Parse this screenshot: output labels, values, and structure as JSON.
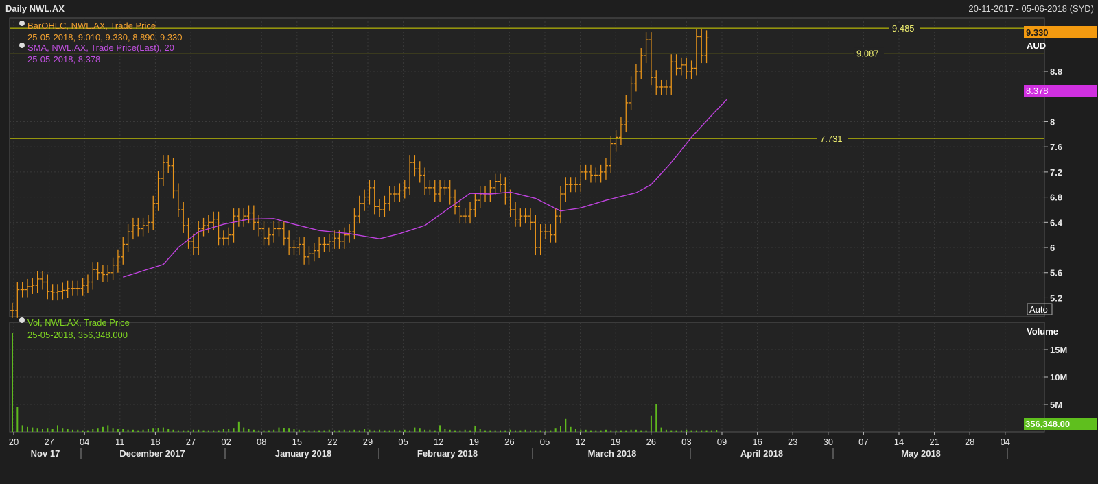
{
  "header": {
    "title": "Daily NWL.AX",
    "date_range": "20-11-2017 - 05-06-2018 (SYD)"
  },
  "colors": {
    "background": "#1e1e1e",
    "panel": "#222222",
    "grid": "#3a3a3a",
    "bar": "#e8941a",
    "sma": "#c043e0",
    "hline": "#d8d800",
    "volume": "#5fb81e",
    "last_price_bg": "#f39a10",
    "sma_bg": "#d030e0"
  },
  "price_panel": {
    "legend": [
      {
        "name": "BarOHLC, NWL.AX, Trade Price",
        "values": "25-05-2018, 9.010, 9.330, 8.890, 9.330",
        "color": "#f0a030"
      },
      {
        "name": "SMA, NWL.AX, Trade Price(Last),  20",
        "values": "25-05-2018, 8.378",
        "color": "#c050e0"
      }
    ],
    "currency": "AUD",
    "auto_label": "Auto",
    "last_price_tag": "9.330",
    "sma_tag": "8.378",
    "hlines": [
      {
        "label": "9.485",
        "value": 9.485
      },
      {
        "label": "9.087",
        "value": 9.087
      },
      {
        "label": "7.731",
        "value": 7.731
      }
    ]
  },
  "volume_panel": {
    "legend": {
      "name": "Vol, NWL.AX, Trade Price",
      "values": "25-05-2018, 356,348.000"
    },
    "title": "Volume",
    "last_volume_tag": "356,348.00"
  },
  "chart_data": [
    {
      "type": "ohlc",
      "series_name": "BarOHLC, NWL.AX, Trade Price",
      "ylim": [
        4.9,
        9.65
      ],
      "yticks": [
        "5.2",
        "5.6",
        "6",
        "6.4",
        "6.8",
        "7.2",
        "7.6",
        "8",
        "8.8"
      ],
      "x_ticks": [
        "20",
        "27",
        "04",
        "11",
        "18",
        "27",
        "02",
        "08",
        "15",
        "22",
        "29",
        "05",
        "12",
        "19",
        "26",
        "05",
        "12",
        "19",
        "26",
        "03",
        "09",
        "16",
        "23",
        "30",
        "07",
        "14",
        "21",
        "28",
        "04"
      ],
      "x_months": [
        "Nov 17",
        "December 2017",
        "January 2018",
        "February 2018",
        "March 2018",
        "April 2018",
        "May 2018"
      ],
      "close": [
        5.0,
        5.33,
        5.33,
        5.38,
        5.4,
        5.5,
        5.45,
        5.3,
        5.28,
        5.3,
        5.32,
        5.35,
        5.35,
        5.35,
        5.4,
        5.45,
        5.65,
        5.6,
        5.57,
        5.6,
        5.72,
        5.85,
        6.05,
        6.25,
        6.35,
        6.3,
        6.35,
        6.4,
        6.7,
        7.1,
        7.35,
        7.3,
        6.9,
        6.6,
        6.35,
        6.1,
        6.0,
        6.3,
        6.35,
        6.4,
        6.45,
        6.15,
        6.15,
        6.2,
        6.5,
        6.45,
        6.5,
        6.55,
        6.4,
        6.3,
        6.15,
        6.2,
        6.3,
        6.3,
        6.15,
        6.0,
        6.0,
        6.05,
        5.85,
        5.9,
        5.95,
        6.05,
        6.05,
        6.1,
        6.15,
        6.1,
        6.2,
        6.25,
        6.5,
        6.7,
        6.8,
        6.95,
        6.65,
        6.6,
        6.7,
        6.85,
        6.85,
        6.9,
        6.95,
        7.35,
        7.25,
        7.15,
        6.95,
        6.95,
        6.85,
        6.95,
        6.95,
        6.8,
        6.65,
        6.5,
        6.5,
        6.6,
        6.75,
        6.85,
        6.85,
        6.95,
        7.05,
        7.0,
        6.8,
        6.6,
        6.45,
        6.5,
        6.5,
        6.4,
        6.0,
        6.25,
        6.25,
        6.2,
        6.5,
        6.85,
        7.0,
        7.0,
        7.0,
        7.2,
        7.2,
        7.15,
        7.15,
        7.2,
        7.3,
        7.65,
        7.75,
        7.95,
        8.3,
        8.6,
        8.8,
        9.05,
        9.3,
        8.7,
        8.55,
        8.55,
        8.55,
        8.95,
        8.85,
        8.9,
        8.8,
        8.85,
        9.35,
        9.05,
        9.33
      ],
      "high_low_spread": 0.12
    },
    {
      "type": "line",
      "series_name": "SMA, NWL.AX, Trade Price(Last),  20",
      "points": [
        [
          22,
          5.53
        ],
        [
          26,
          5.63
        ],
        [
          30,
          5.73
        ],
        [
          33,
          6.0
        ],
        [
          37,
          6.25
        ],
        [
          42,
          6.37
        ],
        [
          47,
          6.45
        ],
        [
          52,
          6.46
        ],
        [
          56,
          6.37
        ],
        [
          61,
          6.27
        ],
        [
          67,
          6.22
        ],
        [
          73,
          6.14
        ],
        [
          77,
          6.22
        ],
        [
          82,
          6.35
        ],
        [
          86,
          6.58
        ],
        [
          91,
          6.86
        ],
        [
          95,
          6.85
        ],
        [
          99,
          6.88
        ],
        [
          104,
          6.78
        ],
        [
          109,
          6.58
        ],
        [
          113,
          6.63
        ],
        [
          118,
          6.75
        ],
        [
          124,
          6.87
        ],
        [
          127,
          7.0
        ],
        [
          131,
          7.35
        ],
        [
          135,
          7.75
        ],
        [
          139,
          8.1
        ],
        [
          142,
          8.35
        ]
      ]
    },
    {
      "type": "bar",
      "series_name": "Vol, NWL.AX, Trade Price",
      "unit": "M",
      "ylim": [
        0,
        20
      ],
      "yticks": [
        "5M",
        "10M",
        "15M"
      ],
      "values": [
        18.0,
        4.5,
        1.2,
        0.9,
        0.8,
        0.6,
        0.5,
        0.6,
        0.5,
        1.2,
        0.6,
        0.5,
        0.4,
        0.4,
        0.3,
        0.3,
        0.5,
        0.6,
        0.9,
        1.2,
        0.6,
        0.5,
        0.5,
        0.4,
        0.4,
        0.3,
        0.4,
        0.5,
        0.6,
        0.7,
        0.8,
        0.5,
        0.4,
        0.3,
        0.3,
        0.3,
        0.4,
        0.4,
        0.3,
        0.3,
        0.3,
        0.3,
        0.5,
        0.5,
        0.6,
        1.9,
        0.8,
        0.5,
        0.4,
        0.3,
        0.3,
        0.3,
        0.4,
        0.8,
        0.7,
        0.6,
        0.5,
        0.4,
        0.3,
        0.3,
        0.3,
        0.3,
        0.3,
        0.4,
        0.3,
        0.3,
        0.4,
        0.3,
        0.4,
        0.3,
        0.5,
        0.4,
        0.3,
        0.4,
        0.3,
        0.3,
        0.4,
        0.3,
        0.4,
        0.3,
        0.8,
        0.6,
        0.4,
        0.4,
        0.3,
        1.2,
        0.5,
        0.4,
        0.3,
        0.3,
        0.4,
        0.3,
        1.1,
        0.5,
        0.3,
        0.3,
        0.3,
        0.3,
        0.3,
        0.4,
        0.3,
        0.3,
        0.4,
        0.3,
        0.3,
        0.3,
        0.3,
        0.3,
        0.6,
        1.1,
        2.4,
        0.9,
        0.5,
        0.4,
        0.4,
        0.3,
        0.3,
        0.3,
        0.4,
        0.3,
        0.3,
        0.3,
        0.3,
        0.4,
        0.4,
        0.3,
        0.3,
        2.9,
        5.0,
        0.8,
        0.4,
        0.3,
        0.3,
        0.3,
        0.4,
        0.3,
        0.3,
        0.3,
        0.3,
        0.3,
        0.36
      ]
    }
  ]
}
